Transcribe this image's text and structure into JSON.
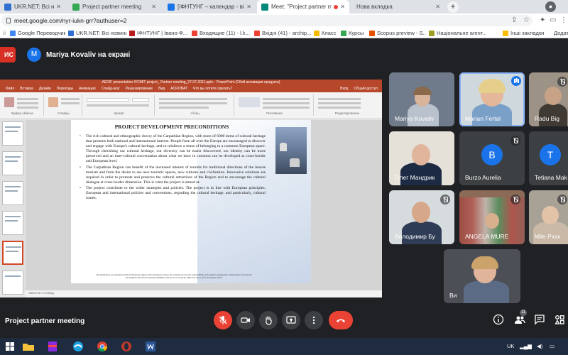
{
  "browser": {
    "tabs": [
      {
        "label": "UKR.NET: Всі новини України, ост",
        "fav": "#2f6fd0"
      },
      {
        "label": "Project partner meeting",
        "fav": "#34a853"
      },
      {
        "label": "[ІФНТУНГ – календар - вівторок",
        "fav": "#1a73e8"
      },
      {
        "label": "Meet: \"Project partner meeti",
        "fav": "#00897b"
      },
      {
        "label": "Нова вкладка",
        "fav": "#9aa0a6"
      }
    ],
    "url": "meet.google.com/nyr-iukn-grr?authuser=2",
    "bookmarks": [
      {
        "label": "Google Переводчик",
        "fav": "#4285f4"
      },
      {
        "label": "UKR.NET: Всі новини...",
        "fav": "#2f6fd0"
      },
      {
        "label": "ІФНТУНГ | Івано-Ф...",
        "fav": "#b71c1c"
      },
      {
        "label": "Входящие (11) - l.k...",
        "fav": "#ea4335"
      },
      {
        "label": "Вхідні (41) - archip...",
        "fav": "#ea4335"
      },
      {
        "label": "Класс",
        "fav": "#fbbc04"
      },
      {
        "label": "Курсы",
        "fav": "#34a853"
      },
      {
        "label": "Scopus preview - S...",
        "fav": "#e65100"
      },
      {
        "label": "Національне агент...",
        "fav": "#9e9d24"
      },
      {
        "label": "Інші закладки",
        "fav": "#fbbc04"
      }
    ],
    "apps_label": "Додатки"
  },
  "meet": {
    "stop_label": "ИС",
    "presenter": {
      "initial": "M",
      "text": "Mariya Kovaliv на екрані"
    },
    "meeting_title": "Project partner meeting",
    "people_count": "11",
    "participants": [
      {
        "name": "Mariya Kovaliv",
        "type": "video"
      },
      {
        "name": "Marian Fertal",
        "type": "video",
        "speaking": true
      },
      {
        "name": "Radu Big",
        "type": "video"
      },
      {
        "name": "Олег Мандрик",
        "type": "video"
      },
      {
        "name": "Burzo Aurelia",
        "type": "avatar",
        "initial": "B",
        "color": "#1a73e8"
      },
      {
        "name": "Tetiana Mak",
        "type": "avatar",
        "initial": "T",
        "color": "#1a73e8"
      },
      {
        "name": "Володимир Бу",
        "type": "video"
      },
      {
        "name": "ANGELA MURE",
        "type": "video"
      },
      {
        "name": "Mile Pxxx",
        "type": "video"
      },
      {
        "name": "Ви",
        "type": "video"
      }
    ]
  },
  "ppt": {
    "window_title": "AEDIF presentation IVCMIT project_ Partner meeting_27.07.2021.pptx - PowerPoint (Сбой активации продукта)",
    "menu": [
      "Файл",
      "Вставка",
      "Дизайн",
      "Переходы",
      "Анимация",
      "Слайд-шоу",
      "Рецензирование",
      "Вид",
      "ACROBAT",
      "Что вы хотите сделать?",
      "Вход",
      "Общий доступ"
    ],
    "ribbon_groups": [
      "Буфер обмена",
      "Слайды",
      "Шрифт",
      "Абзац",
      "Рисование",
      "Редактирование"
    ],
    "notes_label": "Заметки к слайду",
    "slide": {
      "heading": "PROJECT DEVELOPMENT PRECONDITIONS",
      "bullets": [
        "The rich cultural and ethnographic dowry of the Carpathian Region, with more of 6000 items of cultural heritage that presents both national and international interest. People from all over the Europe are encouraged to discover and engage with Europe's cultural heritage, and to reinforce a sense of belonging to a common European space. Through cherishing our cultural heritage, our diversity can be easier discovered, our identity can be more preserved and an inter-cultural conversation about what we have in common can be developed at cross-border and European level.",
        "The Carpathian Region can benefit of the increased interest of tourists for traditional directions of the leisure tourism and from the desire to see new touristic spaces, new cultures and civilization. Innovative solutions are required in order to promote and preserve the cultural attractions of the Region and to encourage the cultural dialogue at cross border dimension. This is what the project is aimed at.",
        "The project contribute to the wider strategies and policies. The project is in line with European principles, European and international policies and conventions, regarding the cultural heritage, and particularly, cultural routes."
      ],
      "footer": "The publication was produced with the financial support of the European Union. Its contents are the sole responsibility of the public organization \"Association of Economic Development of Ivano-Frankivsk (AEDIF)\" and do not necessarily reflect the views of the European Union"
    }
  },
  "taskbar": {
    "lang": "UK"
  }
}
